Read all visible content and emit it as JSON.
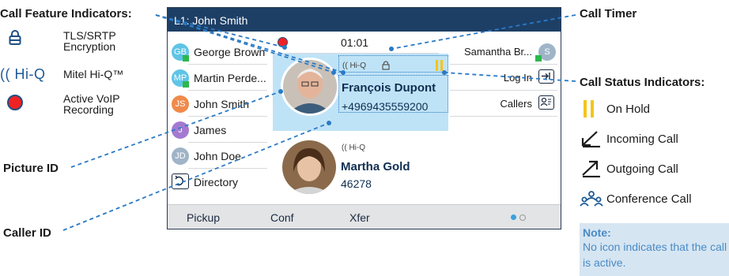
{
  "annotations": {
    "call_feature_indicators": "Call Feature Indicators:",
    "call_timer": "Call Timer",
    "call_status_indicators": "Call Status Indicators:",
    "picture_id": "Picture ID",
    "caller_id": "Caller ID"
  },
  "feature_legend": [
    {
      "icon": "lock-icon",
      "label": "TLS/SRTP\nEncryption"
    },
    {
      "icon": "hi-q-icon",
      "icon_text": "(( Hi-Q",
      "label": "Mitel Hi-Q™"
    },
    {
      "icon": "record-icon",
      "label": "Active VoIP\nRecording"
    }
  ],
  "status_legend": [
    {
      "icon": "on-hold-icon",
      "label": "On Hold",
      "color": "#f5c518"
    },
    {
      "icon": "incoming-call-icon",
      "label": "Incoming Call"
    },
    {
      "icon": "outgoing-call-icon",
      "label": "Outgoing Call"
    },
    {
      "icon": "conference-call-icon",
      "label": "Conference Call",
      "color": "#1e5a96"
    }
  ],
  "note": {
    "title": "Note:",
    "body": "No icon indicates that the call is active."
  },
  "phone": {
    "title": "L1: John Smith",
    "timer": "01:01",
    "left_keys": [
      {
        "initials": "GB",
        "label": "George Brown",
        "color": "#5fc4e6",
        "presence": true
      },
      {
        "initials": "MP",
        "label": "Martin Perde...",
        "color": "#5fc4e6",
        "presence": true
      },
      {
        "initials": "JS",
        "label": "John Smith",
        "color": "#f08a4b",
        "presence": false
      },
      {
        "initials": "J",
        "label": "James",
        "color": "#a47ad1",
        "presence": false
      },
      {
        "initials": "JD",
        "label": "John Doe",
        "color": "#9fb4c7",
        "presence": false
      },
      {
        "initials": "",
        "label": "Directory",
        "color": "",
        "presence": false
      }
    ],
    "right_keys": [
      {
        "label": "Samantha Br...",
        "initials": "S",
        "icon": "avatar"
      },
      {
        "label": "Log In",
        "icon": "login-icon"
      },
      {
        "label": "Callers",
        "icon": "callers-icon"
      }
    ],
    "call1": {
      "name": "François Dupont",
      "number": "+4969435559200",
      "badge": "(( Hi-Q"
    },
    "call2": {
      "name": "Martha Gold",
      "number": "46278",
      "badge": "(( Hi-Q"
    },
    "softkeys": [
      "Pickup",
      "Conf",
      "Xfer"
    ],
    "colors": {
      "titlebar": "#1d3f66",
      "active_call": "#bfe3f6",
      "annotation": "#2a7ac6"
    }
  }
}
